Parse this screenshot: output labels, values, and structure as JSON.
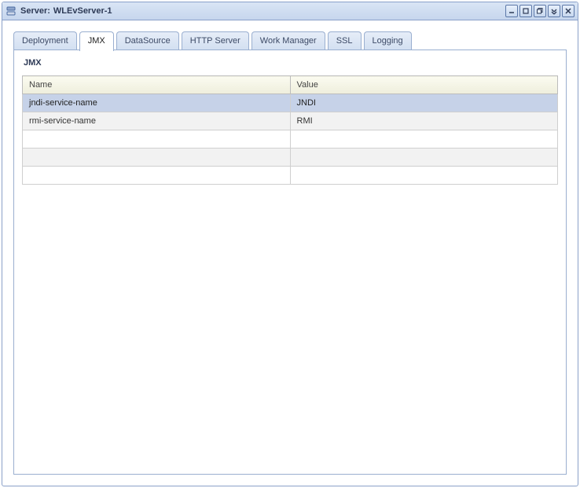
{
  "window": {
    "title_label": "Server:",
    "title_value": "WLEvServer-1"
  },
  "tabs": [
    {
      "id": "deployment",
      "label": "Deployment",
      "active": false
    },
    {
      "id": "jmx",
      "label": "JMX",
      "active": true
    },
    {
      "id": "datasource",
      "label": "DataSource",
      "active": false
    },
    {
      "id": "httpserver",
      "label": "HTTP Server",
      "active": false
    },
    {
      "id": "workmanager",
      "label": "Work Manager",
      "active": false
    },
    {
      "id": "ssl",
      "label": "SSL",
      "active": false
    },
    {
      "id": "logging",
      "label": "Logging",
      "active": false
    }
  ],
  "panel": {
    "title": "JMX",
    "columns": {
      "name": "Name",
      "value": "Value"
    },
    "rows": [
      {
        "name": "jndi-service-name",
        "value": "JNDI",
        "selected": true
      },
      {
        "name": "rmi-service-name",
        "value": "RMI",
        "selected": false
      },
      {
        "name": "",
        "value": "",
        "selected": false
      },
      {
        "name": "",
        "value": "",
        "selected": false
      },
      {
        "name": "",
        "value": "",
        "selected": false
      }
    ]
  }
}
